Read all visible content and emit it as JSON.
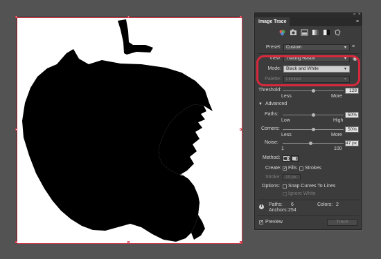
{
  "panel": {
    "title": "Image Trace",
    "collapse_icon": "«",
    "close_icon": "×",
    "menu_icon": "≡",
    "presets": [
      "auto-color-icon",
      "high-color-icon",
      "low-color-icon",
      "grayscale-icon",
      "black-and-white-icon",
      "outline-icon"
    ],
    "preset": {
      "label": "Preset:",
      "value": "Custom"
    },
    "view": {
      "label": "View:",
      "value": "Tracing Result"
    },
    "mode": {
      "label": "Mode:",
      "value": "Black and White"
    },
    "palette": {
      "label": "Palette:",
      "value": "Limited"
    },
    "threshold": {
      "label": "Threshold:",
      "value": "128",
      "min_label": "Less",
      "max_label": "More",
      "fraction": 0.5
    },
    "advanced": {
      "label": "Advanced",
      "expanded": true
    },
    "paths": {
      "label": "Paths:",
      "value": "50%",
      "min_label": "Low",
      "max_label": "High",
      "fraction": 0.5
    },
    "corners": {
      "label": "Corners:",
      "value": "50%",
      "min_label": "Less",
      "max_label": "More",
      "fraction": 0.5
    },
    "noise": {
      "label": "Noise:",
      "value": "47 px",
      "min_label": "1",
      "max_label": "100",
      "fraction": 0.46
    },
    "method": {
      "label": "Method:"
    },
    "create": {
      "label": "Create:",
      "fills_label": "Fills",
      "fills_checked": true,
      "strokes_label": "Strokes",
      "strokes_checked": false
    },
    "stroke": {
      "label": "Stroke:",
      "value": "10 px"
    },
    "options": {
      "label": "Options:",
      "snap_label": "Snap Curves To Lines",
      "snap_checked": false,
      "ignore_white_label": "Ignore White",
      "ignore_white_checked": false
    },
    "info": {
      "paths_label": "Paths:",
      "paths_value": "6",
      "colors_label": "Colors:",
      "colors_value": "2",
      "anchors_label": "Anchors:",
      "anchors_value": "254"
    },
    "preview": {
      "label": "Preview",
      "checked": true
    },
    "trace_button": "Trace"
  },
  "colors": {
    "workspace": "#535353",
    "panel": "#3c3c3c",
    "highlight": "#d8293c",
    "selection": "#d33a4a"
  }
}
